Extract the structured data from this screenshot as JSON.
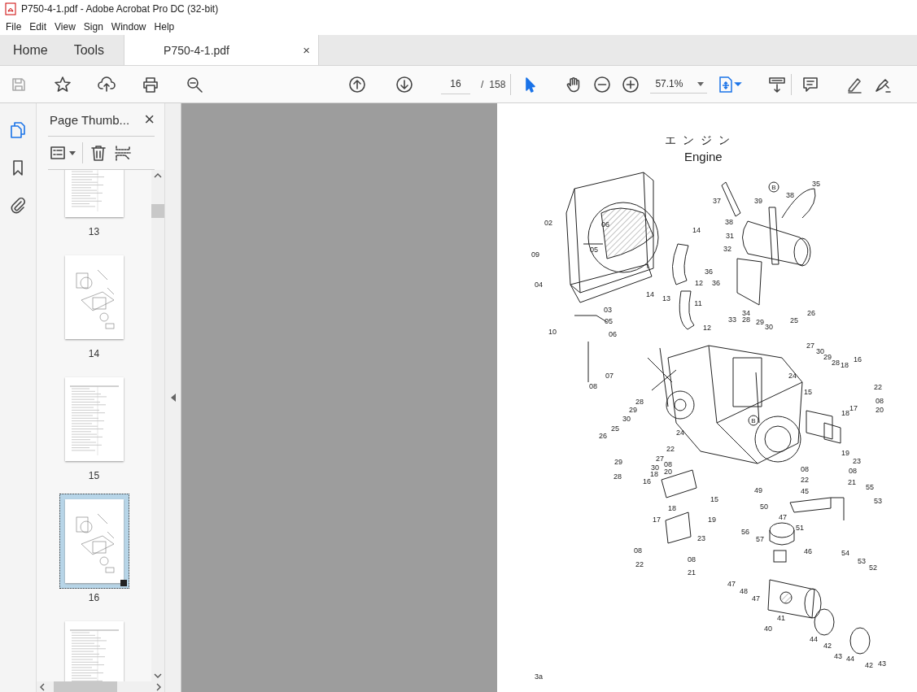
{
  "window": {
    "title": "P750-4-1.pdf - Adobe Acrobat Pro DC (32-bit)"
  },
  "menu": [
    "File",
    "Edit",
    "View",
    "Sign",
    "Window",
    "Help"
  ],
  "tabs": [
    {
      "label": "Home",
      "kind": "nav",
      "selected": false
    },
    {
      "label": "Tools",
      "kind": "nav",
      "selected": false
    },
    {
      "label": "P750-4-1.pdf",
      "kind": "document",
      "selected": true,
      "close": "×"
    }
  ],
  "toolbar": {
    "page_number": "16",
    "page_separator": "/",
    "page_total": "158",
    "zoom": "57.1%"
  },
  "sidebar": {
    "title": "Page Thumb...",
    "close": "×",
    "thumbnails": [
      {
        "label": "13",
        "kind": "parts_list",
        "selected": false
      },
      {
        "label": "14",
        "kind": "diagram",
        "selected": false
      },
      {
        "label": "15",
        "kind": "parts_list",
        "selected": false
      },
      {
        "label": "16",
        "kind": "diagram",
        "selected": true
      },
      {
        "kind": "parts_list",
        "selected": false
      }
    ]
  },
  "page": {
    "title_ja": "エ ン ジ ン",
    "title_en": "Engine",
    "reference_marks": [
      "B",
      "B"
    ],
    "part_labels": [
      "02",
      "06",
      "05",
      "09",
      "04",
      "03",
      "05",
      "06",
      "10",
      "14",
      "14",
      "13",
      "12",
      "11",
      "12",
      "37",
      "38",
      "31",
      "32",
      "39",
      "38",
      "35",
      "36",
      "36",
      "34",
      "33",
      "28",
      "29",
      "30",
      "25",
      "26",
      "07",
      "08",
      "24",
      "27",
      "30",
      "29",
      "28",
      "18",
      "16",
      "15",
      "22",
      "08",
      "17",
      "20",
      "18",
      "19",
      "23",
      "08",
      "08",
      "22",
      "21",
      "28",
      "29",
      "30",
      "25",
      "24",
      "26",
      "22",
      "27",
      "29",
      "30",
      "08",
      "20",
      "28",
      "18",
      "16",
      "15",
      "49",
      "45",
      "55",
      "53",
      "50",
      "47",
      "51",
      "18",
      "17",
      "19",
      "23",
      "56",
      "57",
      "46",
      "54",
      "53",
      "52",
      "08",
      "08",
      "22",
      "21",
      "47",
      "48",
      "47",
      "41",
      "40",
      "44",
      "42",
      "43",
      "44",
      "42",
      "43"
    ],
    "page_number": "3a"
  }
}
